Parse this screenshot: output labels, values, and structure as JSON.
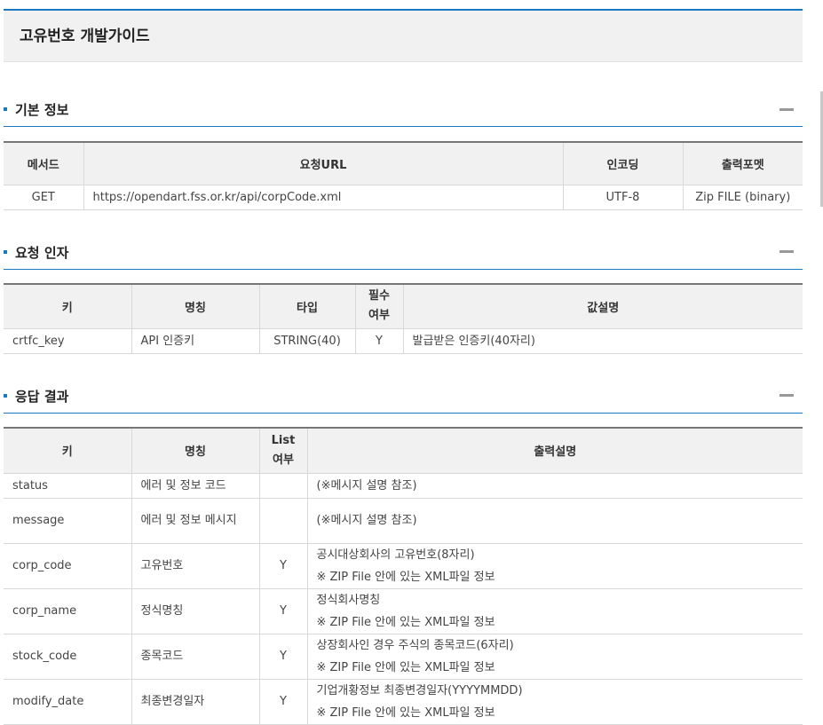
{
  "page_title": "고유번호 개발가이드",
  "collapse_symbol": "—",
  "sections": {
    "basic": {
      "title": "기본 정보",
      "headers": [
        "메서드",
        "요청URL",
        "인코딩",
        "출력포멧"
      ],
      "row": [
        "GET",
        "https://opendart.fss.or.kr/api/corpCode.xml",
        "UTF-8",
        "Zip FILE (binary)"
      ]
    },
    "request": {
      "title": "요청 인자",
      "headers": [
        "키",
        "명칭",
        "타입",
        "필수\n여부",
        "값설명"
      ],
      "row": [
        "crtfc_key",
        "API 인증키",
        "STRING(40)",
        "Y",
        "발급받은 인증키(40자리)"
      ]
    },
    "response": {
      "title": "응답 결과",
      "headers": [
        "키",
        "명칭",
        "List\n여부",
        "출력설명"
      ],
      "rows": [
        {
          "key": "status",
          "name": "에러 및 정보 코드",
          "list": "",
          "desc1": "(※메시지 설명 참조)",
          "desc2": ""
        },
        {
          "key": "message",
          "name": "에러 및 정보 메시지",
          "list": "",
          "desc1": "(※메시지 설명 참조)",
          "desc2": ""
        },
        {
          "key": "corp_code",
          "name": "고유번호",
          "list": "Y",
          "desc1": "공시대상회사의 고유번호(8자리)",
          "desc2": "※ ZIP File 안에 있는 XML파일 정보"
        },
        {
          "key": "corp_name",
          "name": "정식명칭",
          "list": "Y",
          "desc1": "정식회사명칭",
          "desc2": "※ ZIP File 안에 있는 XML파일 정보"
        },
        {
          "key": "stock_code",
          "name": "종목코드",
          "list": "Y",
          "desc1": "상장회사인 경우 주식의 종목코드(6자리)",
          "desc2": "※ ZIP File 안에 있는 XML파일 정보"
        },
        {
          "key": "modify_date",
          "name": "최종변경일자",
          "list": "Y",
          "desc1": "기업개황정보 최종변경일자(YYYYMMDD)",
          "desc2": "※ ZIP File 안에 있는 XML파일 정보"
        }
      ]
    }
  }
}
